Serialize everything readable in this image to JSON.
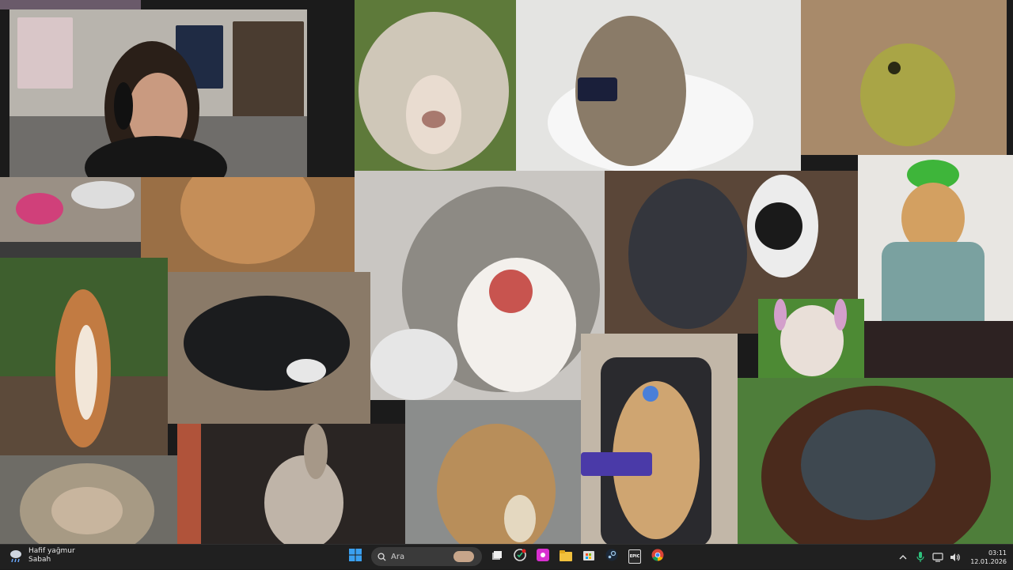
{
  "collage": {
    "tiles": [
      {
        "id": "webcam",
        "label": "Streamer webcam"
      },
      {
        "id": "sheep",
        "label": "Curly sheep"
      },
      {
        "id": "toilet-cat",
        "label": "Cat on toilet with phone"
      },
      {
        "id": "frog",
        "label": "Frog in sand"
      },
      {
        "id": "shocked-cat",
        "label": "Shocked cat"
      },
      {
        "id": "kicking-cat",
        "label": "Cat kicking dog"
      },
      {
        "id": "green-hat-cat",
        "label": "Cat in green hat"
      },
      {
        "id": "squirrel",
        "label": "Cheering squirrel"
      },
      {
        "id": "black-dog",
        "label": "Dog with controller"
      },
      {
        "id": "bunny-bulldog",
        "label": "Bulldog with bunny ears"
      },
      {
        "id": "monkey",
        "label": "Monkey"
      },
      {
        "id": "donkey",
        "label": "Donkey"
      },
      {
        "id": "puppy",
        "label": "Puppy with bread"
      },
      {
        "id": "gamer-cat",
        "label": "Gamer cat with headset"
      },
      {
        "id": "orangutan",
        "label": "Orangutan"
      }
    ]
  },
  "taskbar": {
    "weather_title": "Hafif yağmur",
    "weather_sub": "Sabah",
    "search_placeholder": "Ara",
    "time": "03:11",
    "date": "12.01.2026",
    "epic_label": "EPIC",
    "icons": [
      "windows-start-icon",
      "search-icon",
      "task-view-icon",
      "app-icon",
      "pink-app-icon",
      "file-explorer-icon",
      "store-icon",
      "steam-icon",
      "epic-games-icon",
      "chrome-icon"
    ],
    "tray": [
      "chevron-up-icon",
      "microphone-icon",
      "display-icon",
      "volume-icon"
    ],
    "accent": "#3b8ed8"
  }
}
